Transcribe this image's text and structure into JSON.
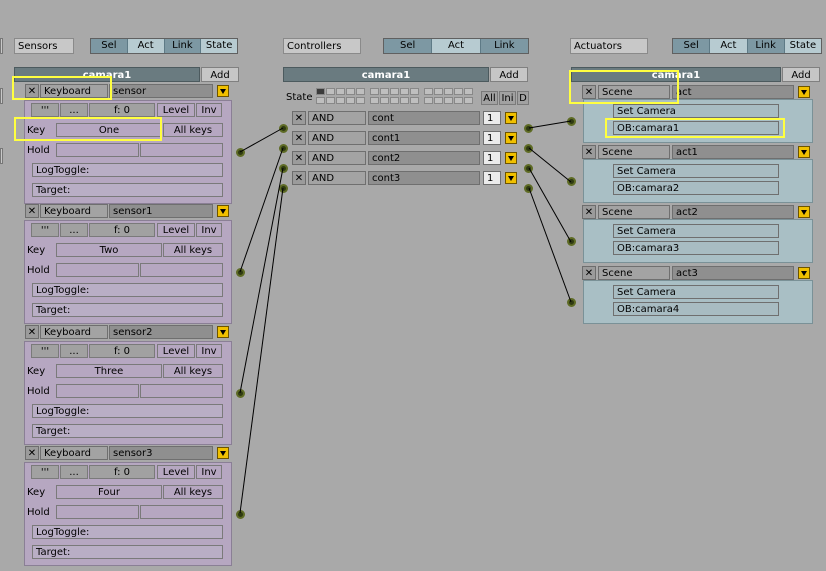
{
  "header": {
    "sensors_label": "Sensors",
    "controllers_label": "Controllers",
    "actuators_label": "Actuators",
    "sensors_tabs": [
      "Sel",
      "Act",
      "Link",
      "State"
    ],
    "controllers_tabs": [
      "Sel",
      "Act",
      "Link"
    ],
    "actuators_tabs": [
      "Sel",
      "Act",
      "Link",
      "State"
    ]
  },
  "object_name": "camara1",
  "add_label": "Add",
  "state_label": "State",
  "state_buttons": [
    "All",
    "Ini",
    "D"
  ],
  "sensors": [
    {
      "type": "Keyboard",
      "name": "sensor",
      "freq": "f: 0",
      "key": "One"
    },
    {
      "type": "Keyboard",
      "name": "sensor1",
      "freq": "f: 0",
      "key": "Two"
    },
    {
      "type": "Keyboard",
      "name": "sensor2",
      "freq": "f: 0",
      "key": "Three"
    },
    {
      "type": "Keyboard",
      "name": "sensor3",
      "freq": "f: 0",
      "key": "Four"
    }
  ],
  "sensor_labels": {
    "level": "Level",
    "inv": "Inv",
    "key": "Key",
    "all_keys": "All keys",
    "hold": "Hold",
    "logtoggle": "LogToggle:",
    "target": "Target:"
  },
  "controllers": [
    {
      "type": "AND",
      "name": "cont",
      "state": "1"
    },
    {
      "type": "AND",
      "name": "cont1",
      "state": "1"
    },
    {
      "type": "AND",
      "name": "cont2",
      "state": "1"
    },
    {
      "type": "AND",
      "name": "cont3",
      "state": "1"
    }
  ],
  "actuators": [
    {
      "type": "Scene",
      "name": "act",
      "mode": "Set Camera",
      "target": "OB:camara1"
    },
    {
      "type": "Scene",
      "name": "act1",
      "mode": "Set Camera",
      "target": "OB:camara2"
    },
    {
      "type": "Scene",
      "name": "act2",
      "mode": "Set Camera",
      "target": "OB:camara3"
    },
    {
      "type": "Scene",
      "name": "act3",
      "mode": "Set Camera",
      "target": "OB:camara4"
    }
  ],
  "colors": {
    "highlight": "#ffff40",
    "sensor_bg": "#b6a7c1",
    "actuator_bg": "#a9bfc5",
    "header_bg": "#6a7b80"
  }
}
